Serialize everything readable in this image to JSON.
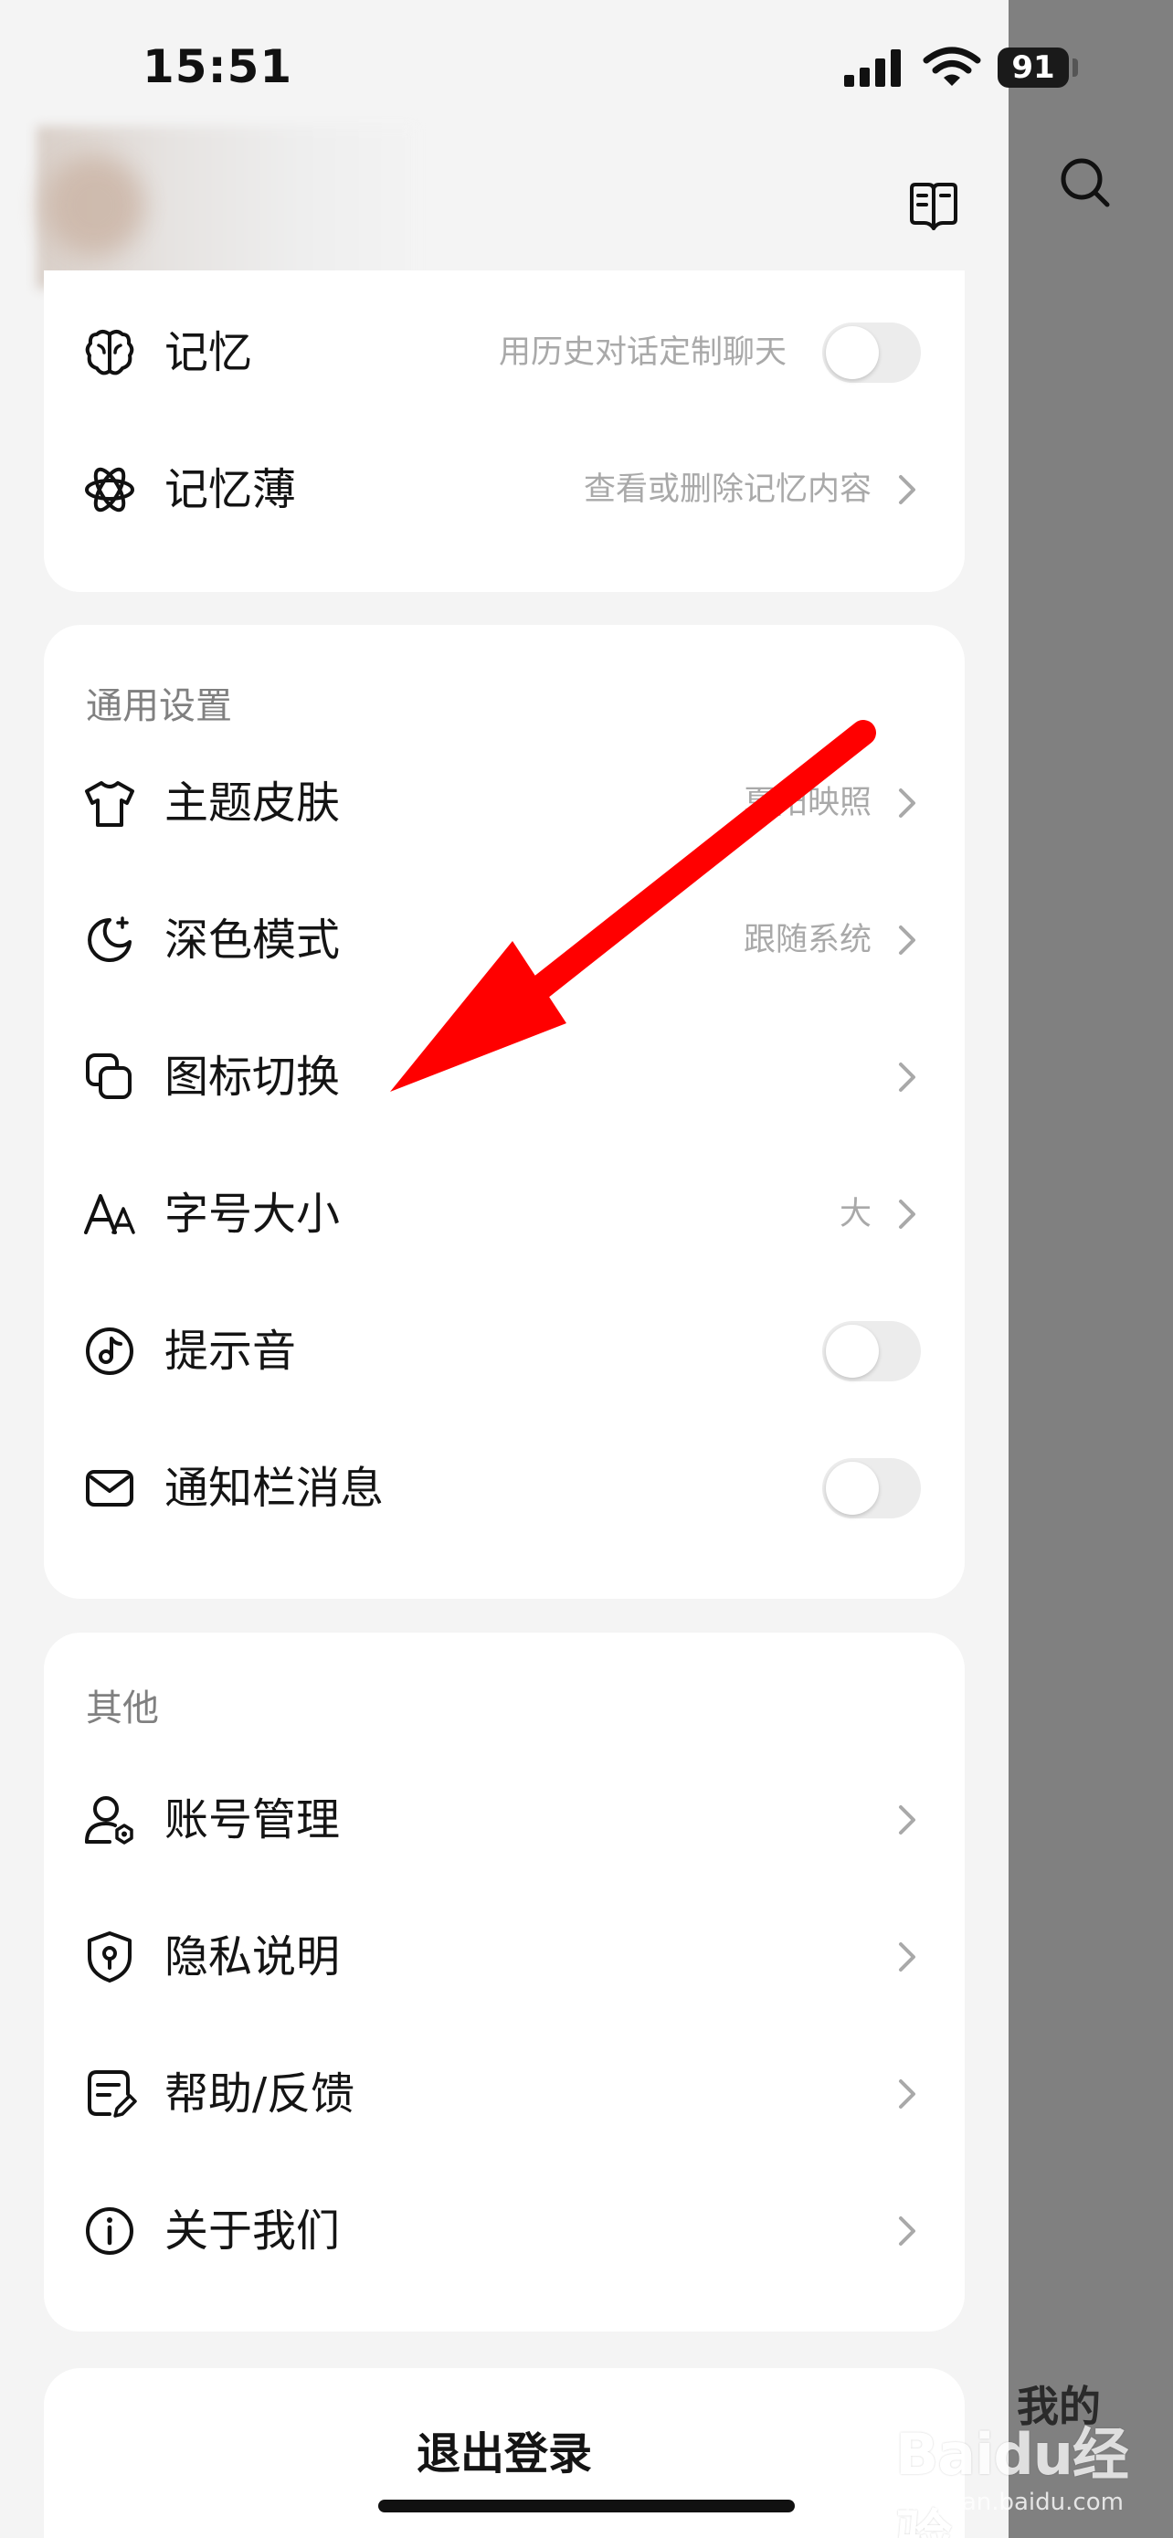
{
  "status_bar": {
    "time": "15:51",
    "battery": "91"
  },
  "memory_card": {
    "rows": [
      {
        "label": "记忆",
        "value": "用历史对话定制聊天",
        "icon": "brain-icon",
        "control": "toggle",
        "on": false
      },
      {
        "label": "记忆薄",
        "value": "查看或删除记忆内容",
        "icon": "atom-icon",
        "control": "chevron"
      }
    ]
  },
  "general_card": {
    "title": "通用设置",
    "rows": [
      {
        "label": "主题皮肤",
        "value": "夏阳映照",
        "icon": "tshirt-icon",
        "control": "chevron"
      },
      {
        "label": "深色模式",
        "value": "跟随系统",
        "icon": "moon-icon",
        "control": "chevron"
      },
      {
        "label": "图标切换",
        "value": "",
        "icon": "layers-icon",
        "control": "chevron"
      },
      {
        "label": "字号大小",
        "value": "大",
        "icon": "font-size-icon",
        "control": "chevron"
      },
      {
        "label": "提示音",
        "value": "",
        "icon": "music-note-icon",
        "control": "toggle",
        "on": false
      },
      {
        "label": "通知栏消息",
        "value": "",
        "icon": "mail-icon",
        "control": "toggle",
        "on": false
      }
    ]
  },
  "other_card": {
    "title": "其他",
    "rows": [
      {
        "label": "账号管理",
        "icon": "account-settings-icon",
        "control": "chevron"
      },
      {
        "label": "隐私说明",
        "icon": "shield-lock-icon",
        "control": "chevron"
      },
      {
        "label": "帮助/反馈",
        "icon": "feedback-icon",
        "control": "chevron"
      },
      {
        "label": "关于我们",
        "icon": "info-icon",
        "control": "chevron"
      }
    ]
  },
  "logout": {
    "label": "退出登录"
  },
  "side_panel": {
    "mine_label": "我的"
  },
  "watermark": {
    "brand": "Baidu经验",
    "sub": "jingyan.baidu.com"
  },
  "colors": {
    "annotation_arrow": "#ff0000",
    "toggle_off": "#ececec",
    "overlay": "#808080"
  }
}
